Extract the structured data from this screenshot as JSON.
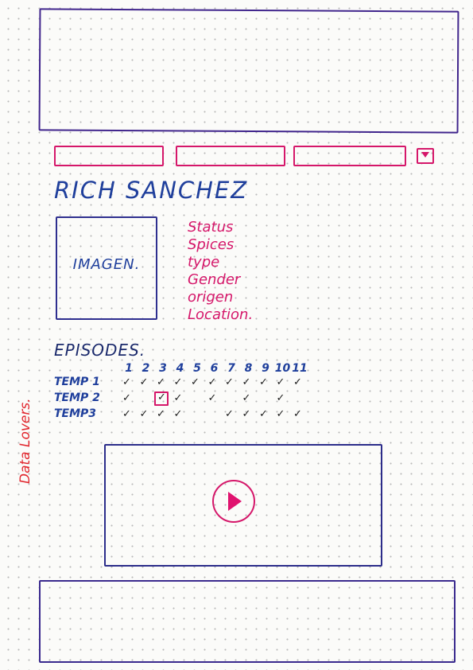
{
  "nav": {
    "menu_icon": "menu-dropdown-icon"
  },
  "character": {
    "name": "RICH SANCHEZ",
    "image_label": "IMAGEN.",
    "attributes": [
      "Status",
      "Spices",
      "type",
      "Gender",
      "origen",
      "Location."
    ]
  },
  "side_note": "Data Lovers.",
  "episodes": {
    "title": "EPISODES.",
    "numbers": [
      "1",
      "2",
      "3",
      "4",
      "5",
      "6",
      "7",
      "8",
      "9",
      "10",
      "11"
    ],
    "seasons": [
      {
        "label": "TEMP 1",
        "watched": [
          true,
          true,
          true,
          true,
          true,
          true,
          true,
          true,
          true,
          true,
          true
        ],
        "selected": -1
      },
      {
        "label": "TEMP 2",
        "watched": [
          true,
          false,
          true,
          true,
          false,
          true,
          false,
          true,
          false,
          true,
          false
        ],
        "selected": 2
      },
      {
        "label": "TEMP3",
        "watched": [
          true,
          true,
          true,
          true,
          false,
          false,
          true,
          true,
          true,
          true,
          true
        ],
        "selected": -1
      }
    ],
    "tick_glyph": "✓"
  },
  "video": {
    "play_icon": "play-icon"
  },
  "colors": {
    "pink": "#d5176a",
    "blue": "#1f3f9c",
    "purple": "#41268d",
    "red_note": "#e1262d"
  }
}
